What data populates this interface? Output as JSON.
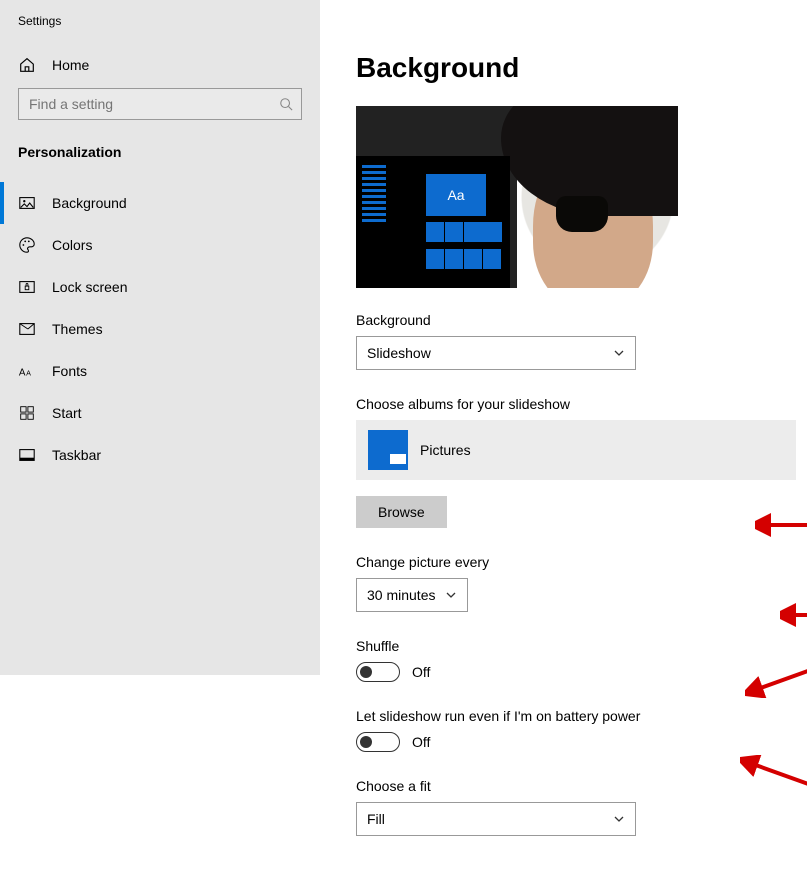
{
  "window": {
    "title": "Settings"
  },
  "sidebar": {
    "home": "Home",
    "search_placeholder": "Find a setting",
    "section": "Personalization",
    "items": [
      {
        "label": "Background",
        "icon": "picture-icon",
        "active": true
      },
      {
        "label": "Colors",
        "icon": "palette-icon",
        "active": false
      },
      {
        "label": "Lock screen",
        "icon": "lockscreen-icon",
        "active": false
      },
      {
        "label": "Themes",
        "icon": "themes-icon",
        "active": false
      },
      {
        "label": "Fonts",
        "icon": "fonts-icon",
        "active": false
      },
      {
        "label": "Start",
        "icon": "start-icon",
        "active": false
      },
      {
        "label": "Taskbar",
        "icon": "taskbar-icon",
        "active": false
      }
    ]
  },
  "main": {
    "heading": "Background",
    "preview_sample_text": "Aa",
    "background_label": "Background",
    "background_value": "Slideshow",
    "albums_label": "Choose albums for your slideshow",
    "album_name": "Pictures",
    "browse_label": "Browse",
    "interval_label": "Change picture every",
    "interval_value": "30 minutes",
    "shuffle_label": "Shuffle",
    "shuffle_value": "Off",
    "battery_label": "Let slideshow run even if I'm on battery power",
    "battery_value": "Off",
    "fit_label": "Choose a fit",
    "fit_value": "Fill"
  },
  "annotations": {
    "arrow_color": "#d40000"
  }
}
